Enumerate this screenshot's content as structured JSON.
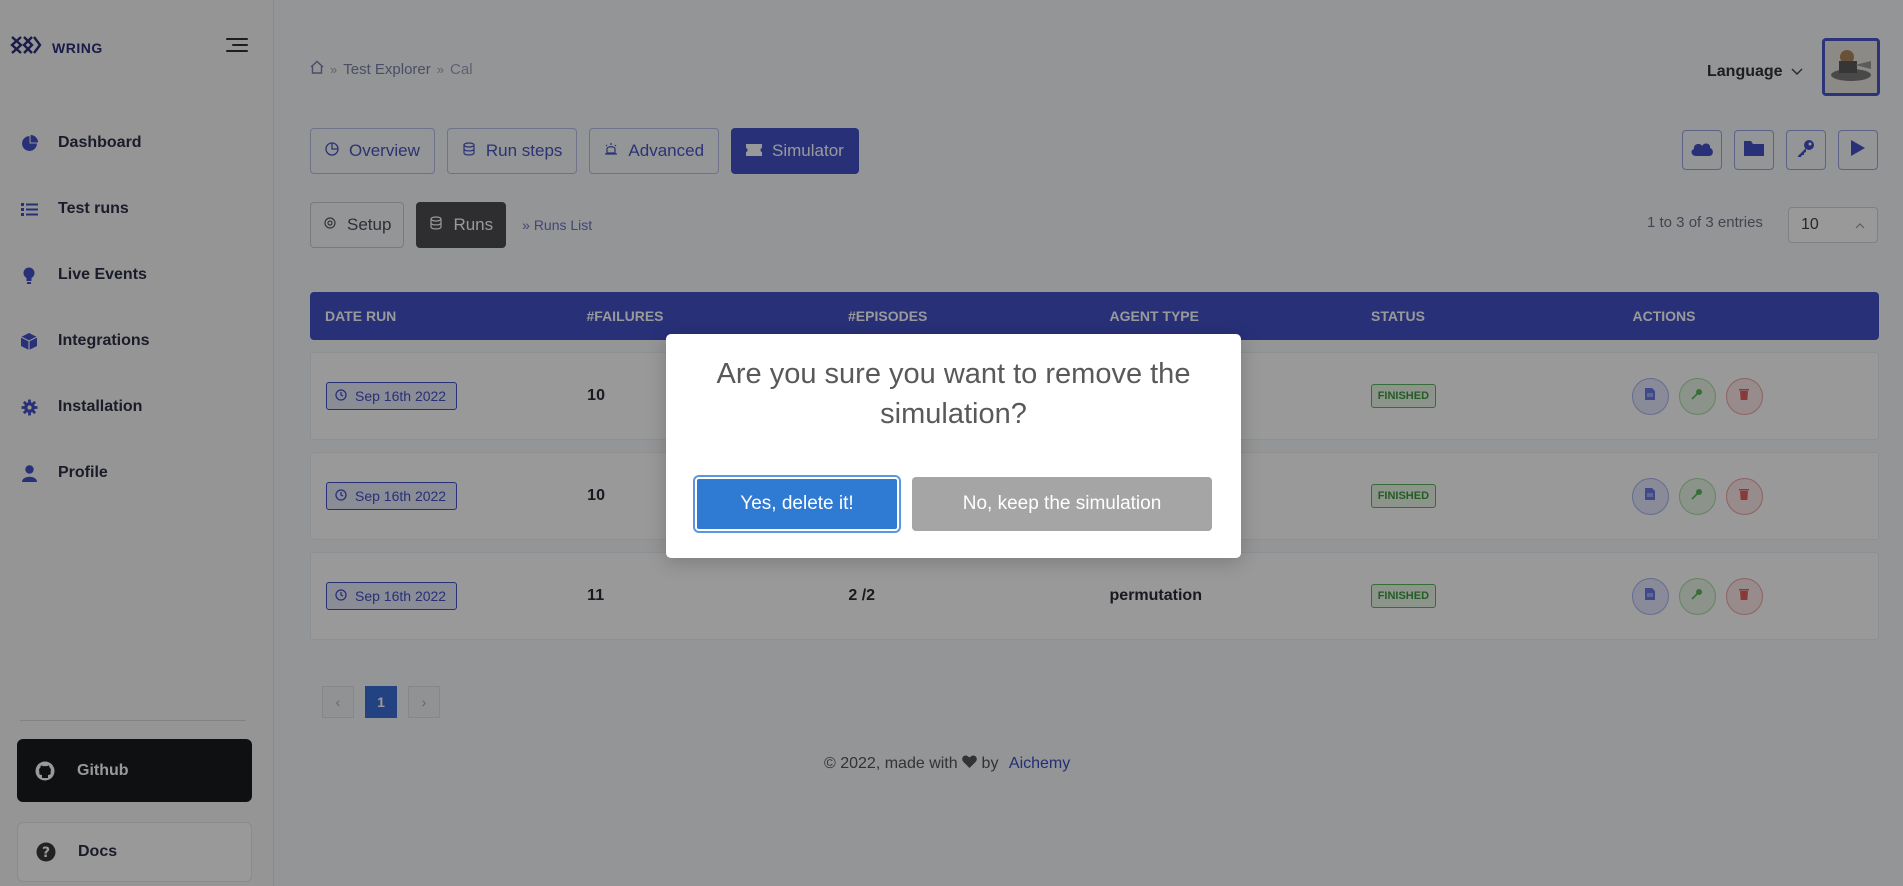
{
  "brand": {
    "name": "WRING"
  },
  "sidebar": {
    "items": [
      {
        "label": "Dashboard",
        "icon": "pie-chart-icon"
      },
      {
        "label": "Test runs",
        "icon": "list-icon"
      },
      {
        "label": "Live Events",
        "icon": "lightbulb-icon"
      },
      {
        "label": "Integrations",
        "icon": "cube-icon"
      },
      {
        "label": "Installation",
        "icon": "gear-icon"
      },
      {
        "label": "Profile",
        "icon": "user-icon"
      }
    ],
    "github_label": "Github",
    "docs_label": "Docs"
  },
  "breadcrumb": {
    "items": [
      "Test Explorer",
      "Cal"
    ]
  },
  "header": {
    "language_label": "Language"
  },
  "tabs": [
    {
      "label": "Overview"
    },
    {
      "label": "Run steps"
    },
    {
      "label": "Advanced"
    },
    {
      "label": "Simulator"
    }
  ],
  "subtabs": [
    {
      "label": "Setup"
    },
    {
      "label": "Runs"
    }
  ],
  "runs_list_label": "Runs List",
  "entries_text": "1 to 3 of 3 entries",
  "page_size": "10",
  "table": {
    "headers": [
      "DATE RUN",
      "#FAILURES",
      "#EPISODES",
      "AGENT TYPE",
      "STATUS",
      "ACTIONS"
    ],
    "rows": [
      {
        "date": "Sep 16th 2022",
        "failures": "10",
        "episodes": "",
        "agent": "",
        "status": "FINISHED"
      },
      {
        "date": "Sep 16th 2022",
        "failures": "10",
        "episodes": "",
        "agent": "",
        "status": "FINISHED"
      },
      {
        "date": "Sep 16th 2022",
        "failures": "11",
        "episodes": "2 /2",
        "agent": "permutation",
        "status": "FINISHED"
      }
    ]
  },
  "pagination": {
    "current": "1",
    "prev": "‹",
    "next": "›"
  },
  "footer": {
    "text": "© 2022, made with",
    "by": "by",
    "link": "Aichemy"
  },
  "dialog": {
    "title": "Are you sure you want to remove the simulation?",
    "confirm_label": "Yes, delete it!",
    "cancel_label": "No, keep the simulation"
  },
  "colors": {
    "accent": "#4350c9",
    "confirm": "#2f7bd3",
    "cancel": "#a5a5a5"
  }
}
